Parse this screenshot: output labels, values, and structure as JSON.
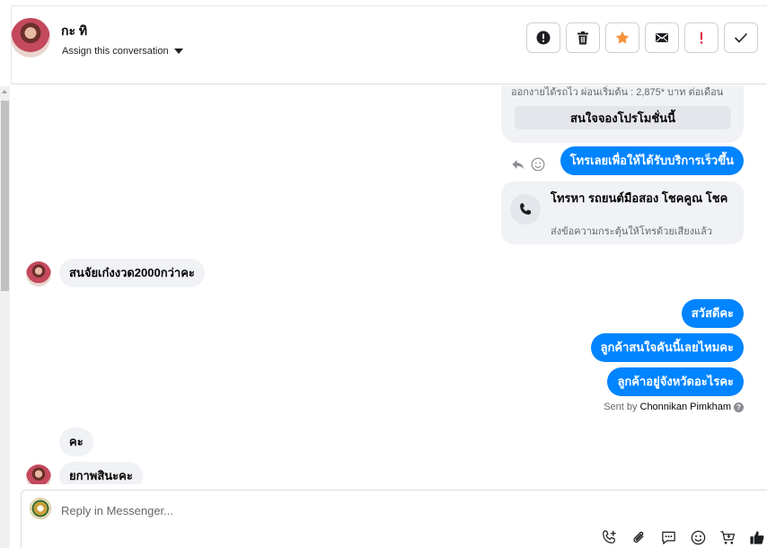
{
  "header": {
    "contact_name": "กะ ทิ",
    "assign_label": "Assign this conversation",
    "actions": [
      {
        "name": "mark-spam-button",
        "icon": "alert-circle-icon"
      },
      {
        "name": "delete-button",
        "icon": "trash-icon"
      },
      {
        "name": "star-button",
        "icon": "star-icon",
        "color": "#f7923b"
      },
      {
        "name": "mark-unread-button",
        "icon": "envelope-icon"
      },
      {
        "name": "follow-up-button",
        "icon": "exclamation-icon",
        "color": "#e41e3f"
      },
      {
        "name": "mark-done-button",
        "icon": "check-icon"
      }
    ]
  },
  "conversation": {
    "promo_card": {
      "cut_text": "ออกงายได้รถไว ผ่อนเริ่มต้น : 2,875* บาท ต่อเดือน",
      "button_label": "สนใจจองโปรโมชั่นนี้"
    },
    "out_call_prompt": "โทรเลยเพื่อให้ได้รับบริการเร็วขึ้น",
    "call_card": {
      "title": "โทรหา รถยนต์มือสอง โชคคูณ โชค",
      "subtitle": "ส่งข้อความกระตุ้นให้โทรด้วยเสียงแล้ว"
    },
    "in_budget": "สนจัยเก๋งงวด2000กว่าคะ",
    "out_messages": [
      "สวัสดีคะ",
      "ลูกค้าสนใจคันนี้เลยไหมคะ",
      "ลูกค้าอยู่จังหวัดอะไรคะ"
    ],
    "sent_by": {
      "prefix": "Sent by",
      "name": "Chonnikan Pimkham",
      "info": "?"
    },
    "in_ka": "คะ",
    "in_last": "ยกาพสินะคะ"
  },
  "composer": {
    "placeholder": "Reply in Messenger...",
    "tools": [
      "call-add-icon",
      "paperclip-icon",
      "saved-reply-icon",
      "emoji-icon",
      "cart-icon",
      "thumbs-up-icon"
    ]
  },
  "colors": {
    "brand_blue": "#0084ff",
    "incoming_bg": "#f0f2f5",
    "star": "#f7923b",
    "alert_red": "#e41e3f"
  }
}
